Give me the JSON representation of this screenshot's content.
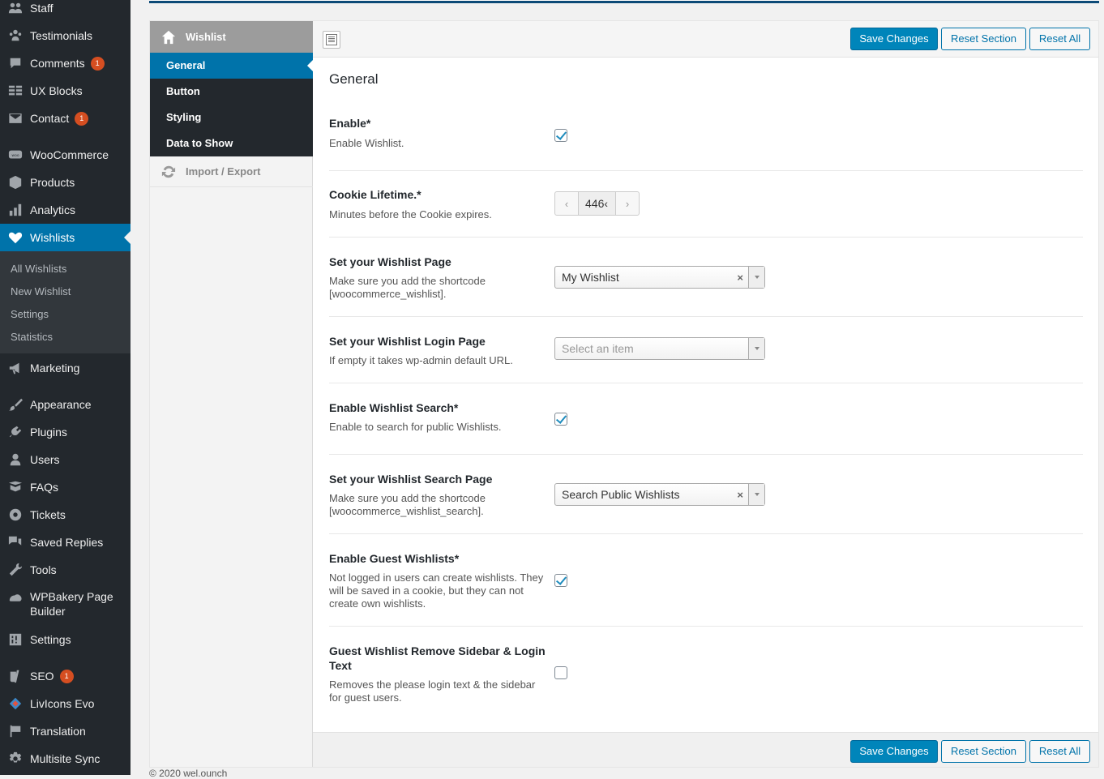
{
  "sidebar": {
    "items": [
      {
        "label": "Staff",
        "icon": "staff-icon"
      },
      {
        "label": "Testimonials",
        "icon": "testimonials-icon"
      },
      {
        "label": "Comments",
        "icon": "comments-icon",
        "badge": "1"
      },
      {
        "label": "UX Blocks",
        "icon": "ux-blocks-icon"
      },
      {
        "label": "Contact",
        "icon": "contact-icon",
        "badge": "1"
      },
      {
        "label": "WooCommerce",
        "icon": "woocommerce-icon"
      },
      {
        "label": "Products",
        "icon": "products-icon"
      },
      {
        "label": "Analytics",
        "icon": "analytics-icon"
      },
      {
        "label": "Wishlists",
        "icon": "heart-icon",
        "current": true
      },
      {
        "label": "Marketing",
        "icon": "megaphone-icon"
      },
      {
        "label": "Appearance",
        "icon": "brush-icon"
      },
      {
        "label": "Plugins",
        "icon": "plugin-icon"
      },
      {
        "label": "Users",
        "icon": "users-icon"
      },
      {
        "label": "FAQs",
        "icon": "faqs-icon"
      },
      {
        "label": "Tickets",
        "icon": "tickets-icon"
      },
      {
        "label": "Saved Replies",
        "icon": "saved-replies-icon"
      },
      {
        "label": "Tools",
        "icon": "wrench-icon"
      },
      {
        "label": "WPBakery Page Builder",
        "icon": "wpbakery-icon"
      },
      {
        "label": "Settings",
        "icon": "settings-icon"
      },
      {
        "label": "SEO",
        "icon": "yoast-icon",
        "badge": "1"
      },
      {
        "label": "LivIcons Evo",
        "icon": "livicons-icon"
      },
      {
        "label": "Translation",
        "icon": "flag-icon"
      },
      {
        "label": "Multisite Sync",
        "icon": "gear-icon"
      }
    ],
    "submenu": [
      "All Wishlists",
      "New Wishlist",
      "Settings",
      "Statistics"
    ]
  },
  "tabs": {
    "head": "Wishlist",
    "sub": [
      "General",
      "Button",
      "Styling",
      "Data to Show"
    ],
    "import_export": "Import / Export"
  },
  "toolbar": {
    "save_label": "Save Changes",
    "reset_section_label": "Reset Section",
    "reset_all_label": "Reset All"
  },
  "section": {
    "title": "General",
    "fields": [
      {
        "title": "Enable*",
        "desc": "Enable Wishlist.",
        "type": "checkbox",
        "checked": true
      },
      {
        "title": "Cookie Lifetime.*",
        "desc": "Minutes before the Cookie expires.",
        "type": "spinner",
        "value": "446‹"
      },
      {
        "title": "Set your Wishlist Page",
        "desc": "Make sure you add the shortcode [woocommerce_wishlist].",
        "type": "select",
        "value": "My Wishlist",
        "clear": "×"
      },
      {
        "title": "Set your Wishlist Login Page",
        "desc": "If empty it takes wp-admin default URL.",
        "type": "select",
        "placeholder": "Select an item"
      },
      {
        "title": "Enable Wishlist Search*",
        "desc": "Enable to search for public Wishlists.",
        "type": "checkbox",
        "checked": true
      },
      {
        "title": "Set your Wishlist Search Page",
        "desc": "Make sure you add the shortcode [woocommerce_wishlist_search].",
        "type": "select",
        "value": "Search Public Wishlists",
        "clear": "×"
      },
      {
        "title": "Enable Guest Wishlists*",
        "desc": "Not logged in users can create wishlists. They will be saved in a cookie, but they can not create own wishlists.",
        "type": "checkbox",
        "checked": true
      },
      {
        "title": "Guest Wishlist Remove Sidebar & Login Text",
        "desc": "Removes the please login text & the sidebar for guest users.",
        "type": "checkbox",
        "checked": false
      }
    ]
  },
  "footer": {
    "text": "© 2020 wel.ounch"
  }
}
